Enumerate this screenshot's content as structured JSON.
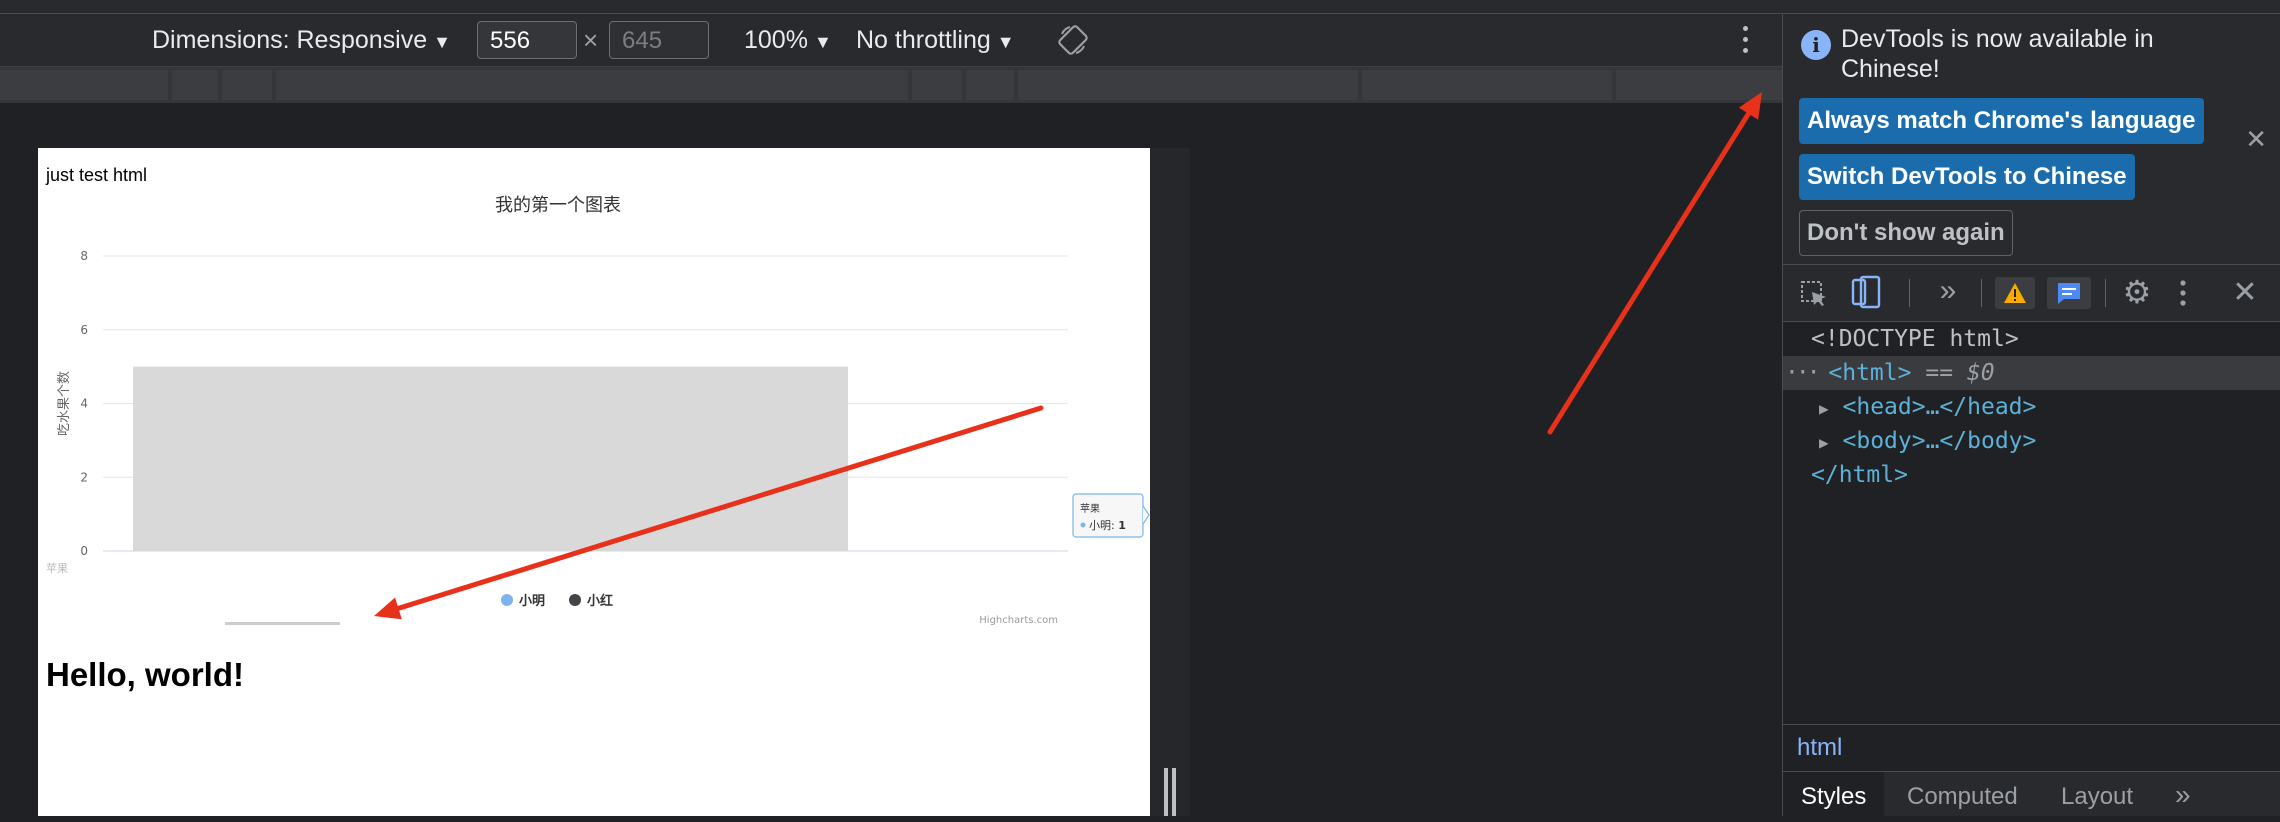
{
  "device_toolbar": {
    "dimensions_label": "Dimensions: Responsive",
    "width_value": "556",
    "height_placeholder": "645",
    "times_symbol": "×",
    "zoom_label": "100%",
    "throttling_label": "No throttling"
  },
  "page": {
    "heading_text": "just test html",
    "hello_text": "Hello, world!"
  },
  "chart_data": {
    "type": "bar",
    "title": "我的第一个图表",
    "ylabel": "吃水果个数",
    "categories": [
      "苹果"
    ],
    "series": [
      {
        "name": "小明",
        "values": [
          1
        ],
        "color": "#7cb5ec"
      },
      {
        "name": "小红",
        "values": [
          5
        ],
        "color": "#434348"
      }
    ],
    "ylim": [
      0,
      8
    ],
    "yticks": [
      "0",
      "2",
      "4",
      "6",
      "8"
    ],
    "grid": true,
    "legend_position": "bottom",
    "credits": "Highcharts.com",
    "tooltip": {
      "category": "苹果",
      "series": "小明",
      "value": "1"
    },
    "hover_color": "#d9d9d9"
  },
  "devtools": {
    "info_message": "DevTools is now available in Chinese!",
    "btn_match": "Always match Chrome's language",
    "btn_switch": "Switch DevTools to Chinese",
    "btn_dont_show": "Don't show again",
    "elements": {
      "doctype": "<!DOCTYPE html>",
      "html_open": "<html>",
      "selected_marker": "== $0",
      "head": "<head>…</head>",
      "body": "<body>…</body>",
      "html_close": "</html>"
    },
    "breadcrumb": "html",
    "tabs": [
      "Styles",
      "Computed",
      "Layout"
    ]
  },
  "colors": {
    "annotation_arrow": "#e8311a",
    "primary_button": "#1a6cad",
    "tag_color": "#5db0d7"
  }
}
